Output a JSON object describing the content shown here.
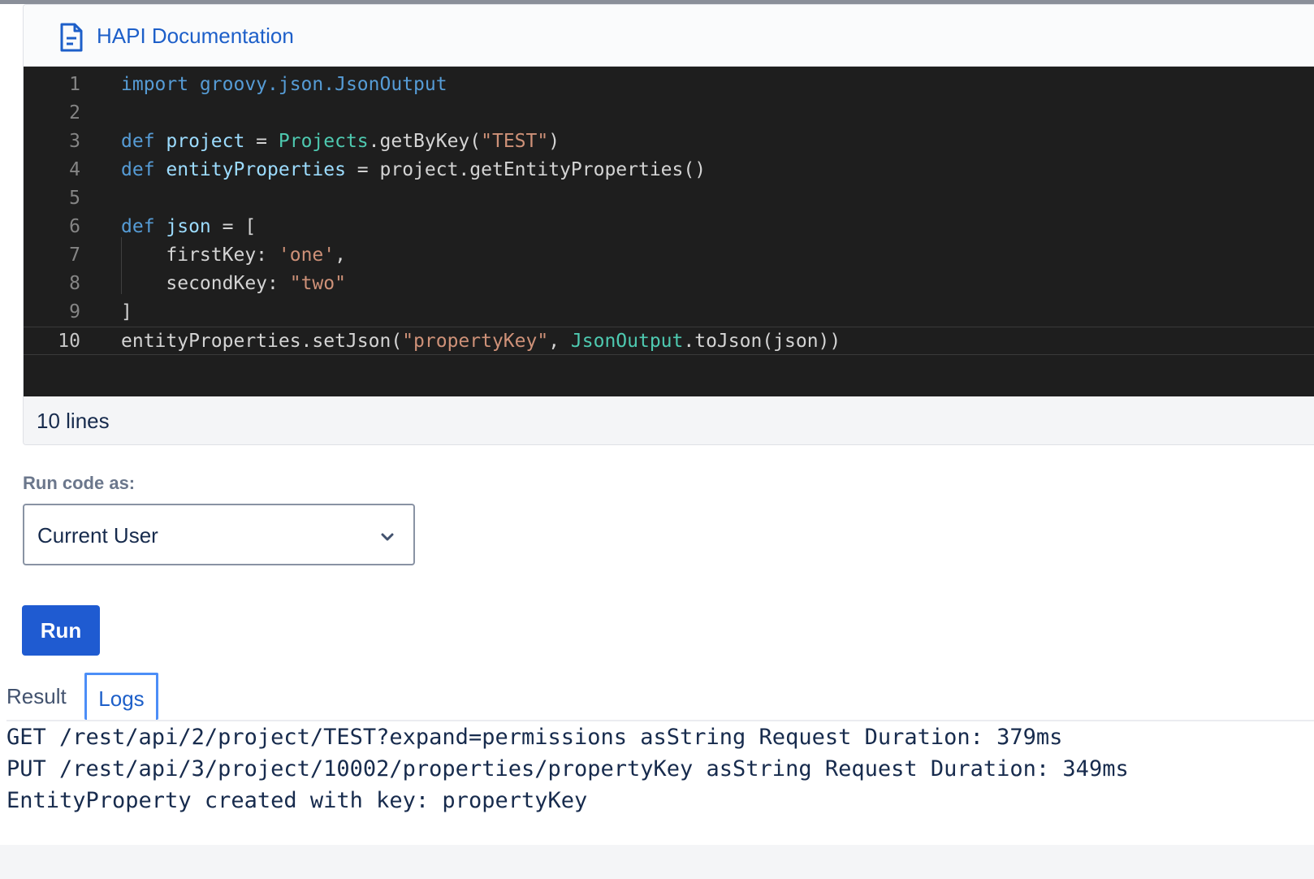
{
  "header": {
    "doc_link": "HAPI Documentation"
  },
  "editor": {
    "lines": [
      {
        "n": "1",
        "tokens": [
          {
            "t": "import groovy.json.JsonOutput",
            "c": "kw"
          }
        ]
      },
      {
        "n": "2",
        "tokens": []
      },
      {
        "n": "3",
        "tokens": [
          {
            "t": "def ",
            "c": "kw"
          },
          {
            "t": "project",
            "c": "var"
          },
          {
            "t": " = ",
            "c": "pln"
          },
          {
            "t": "Projects",
            "c": "cls"
          },
          {
            "t": ".getByKey(",
            "c": "pln"
          },
          {
            "t": "\"TEST\"",
            "c": "str"
          },
          {
            "t": ")",
            "c": "pln"
          }
        ]
      },
      {
        "n": "4",
        "tokens": [
          {
            "t": "def ",
            "c": "kw"
          },
          {
            "t": "entityProperties",
            "c": "var"
          },
          {
            "t": " = project.getEntityProperties()",
            "c": "pln"
          }
        ]
      },
      {
        "n": "5",
        "tokens": []
      },
      {
        "n": "6",
        "tokens": [
          {
            "t": "def ",
            "c": "kw"
          },
          {
            "t": "json",
            "c": "var"
          },
          {
            "t": " = [",
            "c": "pln"
          }
        ]
      },
      {
        "n": "7",
        "tokens": [
          {
            "t": "    firstKey: ",
            "c": "pln"
          },
          {
            "t": "'one'",
            "c": "str"
          },
          {
            "t": ",",
            "c": "pln"
          }
        ]
      },
      {
        "n": "8",
        "tokens": [
          {
            "t": "    secondKey: ",
            "c": "pln"
          },
          {
            "t": "\"two\"",
            "c": "str"
          }
        ]
      },
      {
        "n": "9",
        "tokens": [
          {
            "t": "]",
            "c": "pln"
          }
        ]
      },
      {
        "n": "10",
        "tokens": [
          {
            "t": "entityProperties.setJson(",
            "c": "pln"
          },
          {
            "t": "\"propertyKey\"",
            "c": "str"
          },
          {
            "t": ", ",
            "c": "pln"
          },
          {
            "t": "JsonOutput",
            "c": "cls"
          },
          {
            "t": ".toJson(json))",
            "c": "pln"
          }
        ]
      }
    ],
    "active_line": "10",
    "footer": "10 lines"
  },
  "run_as": {
    "label": "Run code as:",
    "selected": "Current User"
  },
  "run_button": "Run",
  "tabs": {
    "result": "Result",
    "logs": "Logs",
    "active": "logs"
  },
  "logs": [
    "GET /rest/api/2/project/TEST?expand=permissions asString Request Duration: 379ms",
    "PUT /rest/api/3/project/10002/properties/propertyKey asString Request Duration: 349ms",
    "EntityProperty created with key: propertyKey"
  ],
  "colors": {
    "accent": "#1d5fc9",
    "button": "#1f5bd1",
    "editor_bg": "#1e1e1e"
  },
  "icons": {
    "doc": "document-icon",
    "select": "chevron-down-icon"
  }
}
